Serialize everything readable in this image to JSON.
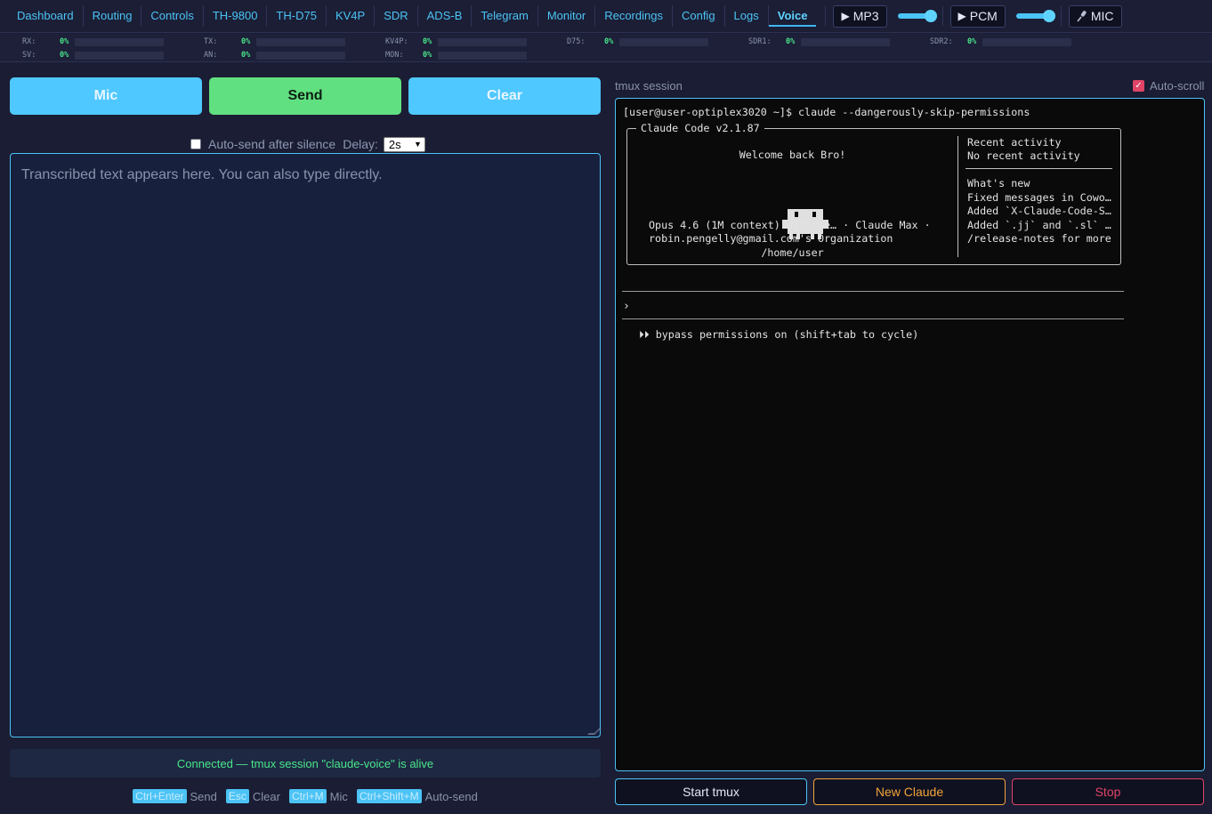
{
  "nav": {
    "tabs": [
      "Dashboard",
      "Routing",
      "Controls",
      "TH-9800",
      "TH-D75",
      "KV4P",
      "SDR",
      "ADS-B",
      "Telegram",
      "Monitor",
      "Recordings",
      "Config",
      "Logs",
      "Voice"
    ],
    "active": "Voice",
    "mp3_label": "MP3",
    "pcm_label": "PCM",
    "mic_label": "MIC",
    "play_glyph": "▶",
    "mic_glyph": "🎤"
  },
  "meters": [
    {
      "label": "RX:",
      "value": "0%"
    },
    {
      "label": "TX:",
      "value": "0%"
    },
    {
      "label": "KV4P:",
      "value": "0%"
    },
    {
      "label": "D75:",
      "value": "0%"
    },
    {
      "label": "SDR1:",
      "value": "0%"
    },
    {
      "label": "SDR2:",
      "value": "0%"
    },
    {
      "label": "SV:",
      "value": "0%"
    },
    {
      "label": "AN:",
      "value": "0%"
    },
    {
      "label": "MON:",
      "value": "0%"
    }
  ],
  "left": {
    "mic_label": "Mic",
    "send_label": "Send",
    "clear_label": "Clear",
    "autosend_label": "Auto-send after silence",
    "delay_label": "Delay:",
    "delay_value": "2s",
    "placeholder": "Transcribed text appears here. You can also type directly.",
    "status": "Connected — tmux session \"claude-voice\" is alive",
    "shortcuts": [
      {
        "key": "Ctrl+Enter",
        "action": "Send"
      },
      {
        "key": "Esc",
        "action": "Clear"
      },
      {
        "key": "Ctrl+M",
        "action": "Mic"
      },
      {
        "key": "Ctrl+Shift+M",
        "action": "Auto-send"
      }
    ]
  },
  "right": {
    "session_label": "tmux session",
    "autoscroll_label": "Auto-scroll",
    "terminal": {
      "prompt": "[user@user-optiplex3020 ~]$ claude --dangerously-skip-permissions",
      "box_title": "Claude Code v2.1.87",
      "welcome": "Welcome back Bro!",
      "model": "Opus 4.6 (1M context) with me… · Claude Max ·",
      "org": "robin.pengelly@gmail.com's Organization",
      "cwd": "/home/user",
      "recent_title": "Recent activity",
      "recent_none": "No recent activity",
      "whats_new": "What's new",
      "news": [
        "Fixed messages in Cowo…",
        "Added `X-Claude-Code-S…",
        "Added `.jj` and `.sl` …",
        "/release-notes for more"
      ],
      "input_prompt": "›",
      "mode": "⏵⏵ bypass permissions on (shift+tab to cycle)"
    },
    "start_label": "Start tmux",
    "new_label": "New Claude",
    "stop_label": "Stop"
  }
}
